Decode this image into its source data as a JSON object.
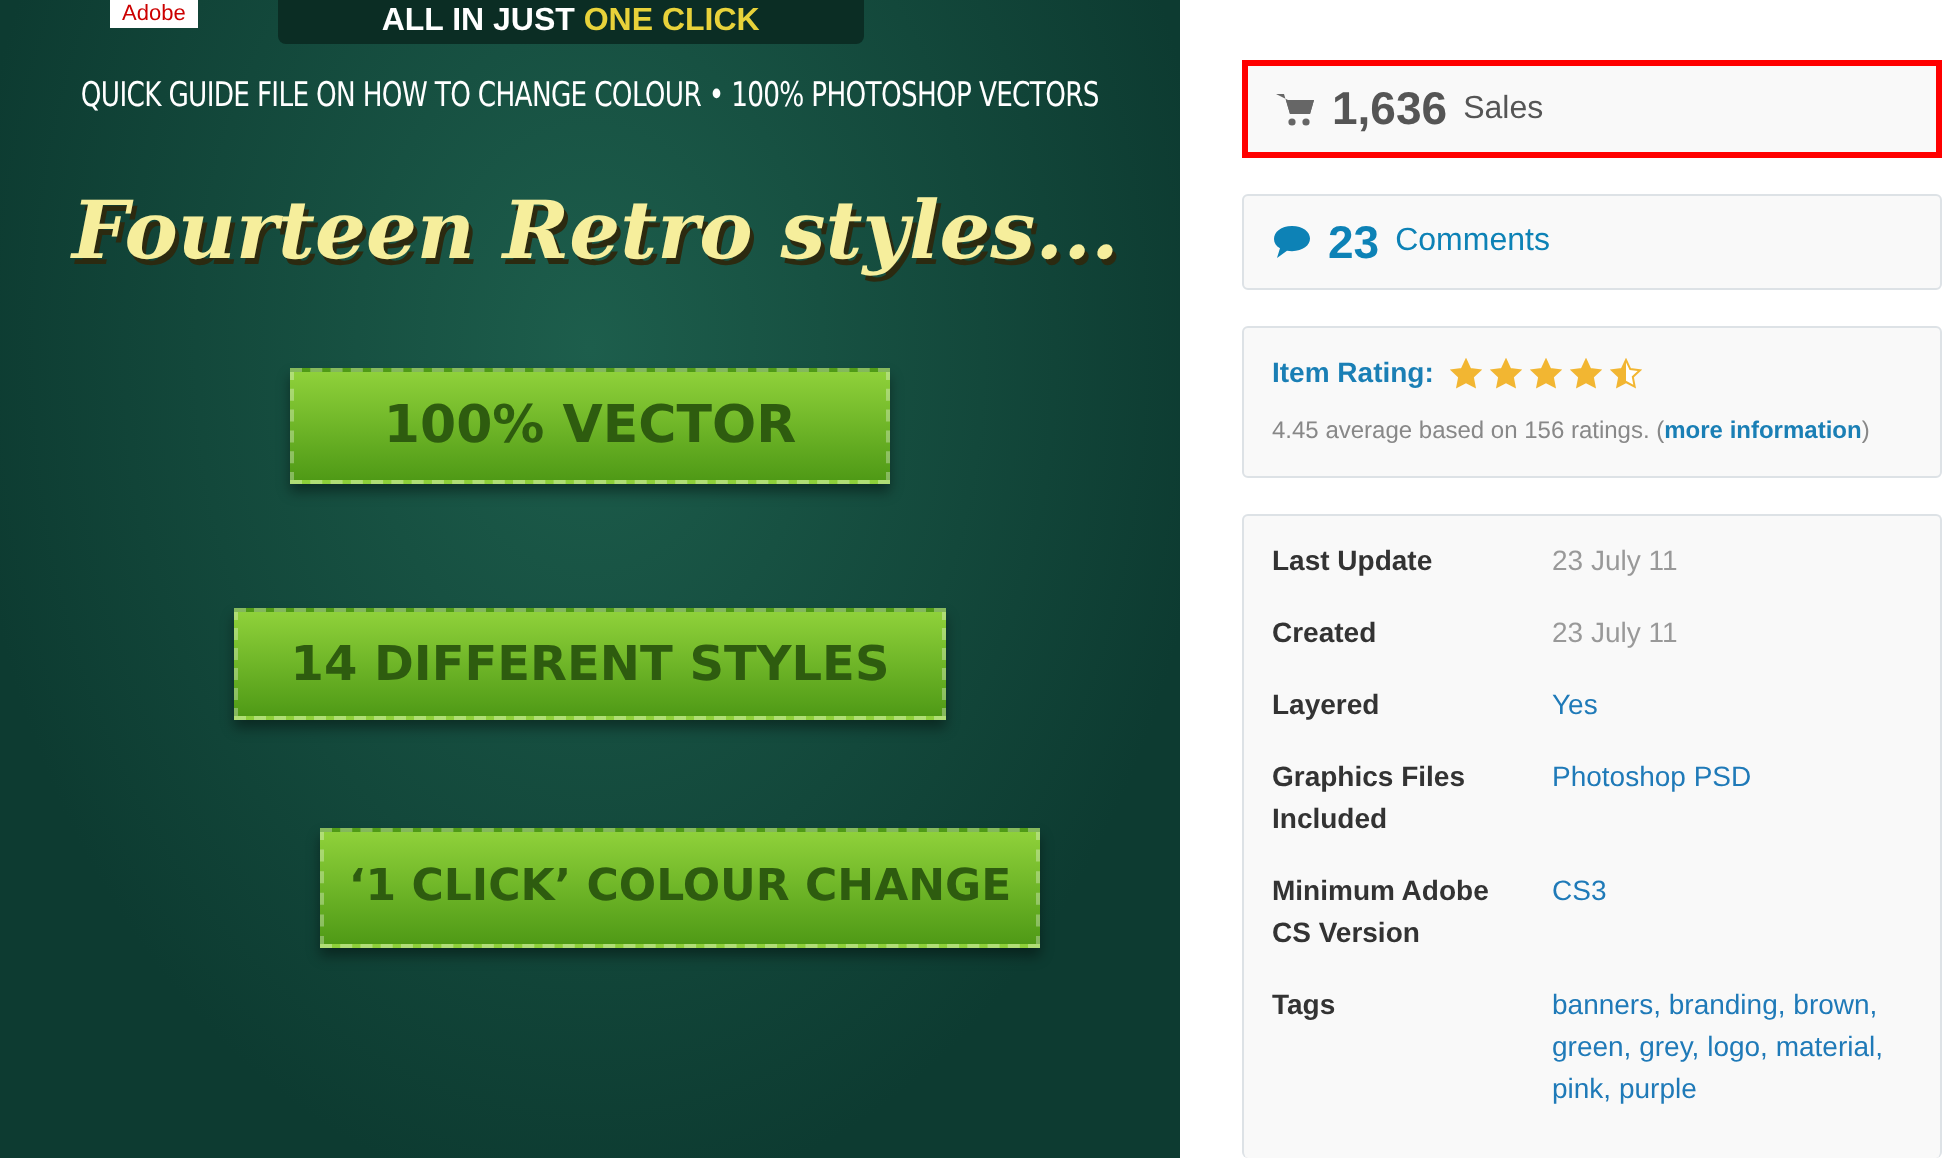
{
  "preview": {
    "adobe_badge": "Adobe",
    "top_banner": {
      "text": "ALL IN JUST",
      "highlight": "ONE CLICK"
    },
    "subtitle": "QUICK GUIDE FILE ON HOW TO CHANGE COLOUR • 100% PHOTOSHOP VECTORS",
    "headline": "Fourteen Retro styles...",
    "ribbons": [
      "100% VECTOR",
      "14 DIFFERENT STYLES",
      "‘1 CLICK’ COLOUR CHANGE"
    ]
  },
  "sales": {
    "count": "1,636",
    "label": "Sales",
    "highlighted": true
  },
  "comments": {
    "count": "23",
    "label": "Comments"
  },
  "rating": {
    "label": "Item Rating:",
    "stars": 4.5,
    "summary": "4.45 average based on 156 ratings. (",
    "link": "more information",
    "summary_end": ")"
  },
  "details": [
    {
      "label": "Last Update",
      "value": "23 July 11",
      "kind": "text"
    },
    {
      "label": "Created",
      "value": "23 July 11",
      "kind": "text"
    },
    {
      "label": "Layered",
      "value": "Yes",
      "kind": "link"
    },
    {
      "label": "Graphics Files Included",
      "value": "Photoshop PSD",
      "kind": "link"
    },
    {
      "label": "Minimum Adobe CS Version",
      "value": "CS3",
      "kind": "link"
    },
    {
      "label": "Tags",
      "kind": "tags",
      "tags": [
        "banners,",
        "branding,",
        "brown,",
        "green,",
        "grey,",
        "logo,",
        "material,",
        "pink,",
        "purple"
      ]
    }
  ]
}
